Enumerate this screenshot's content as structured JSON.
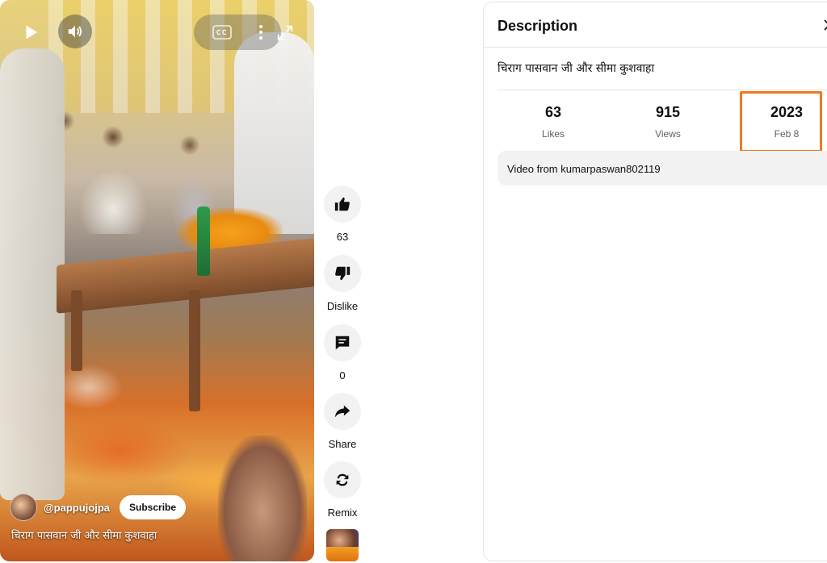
{
  "player": {
    "overlay": {
      "channel_handle": "@pappujojpa",
      "subscribe_label": "Subscribe",
      "title": "चिराग पासवान जी और सीमा कुशवाहा"
    },
    "icons": {
      "play": "play-icon",
      "volume": "volume-icon",
      "captions": "captions-icon",
      "more": "more-vertical-icon",
      "fullscreen": "fullscreen-icon"
    }
  },
  "rail": {
    "like": {
      "label": "63",
      "icon": "thumbs-up-icon"
    },
    "dislike": {
      "label": "Dislike",
      "icon": "thumbs-down-icon"
    },
    "comments": {
      "label": "0",
      "icon": "comment-icon"
    },
    "share": {
      "label": "Share",
      "icon": "share-icon"
    },
    "remix": {
      "label": "Remix",
      "icon": "remix-icon"
    }
  },
  "description": {
    "title": "Description",
    "text": "चिराग पासवान जी और सीमा कुशवाहा",
    "stats": {
      "likes": {
        "value": "63",
        "label": "Likes"
      },
      "views": {
        "value": "915",
        "label": "Views"
      },
      "date": {
        "value": "2023",
        "label": "Feb 8"
      }
    },
    "source": "Video from kumarpaswan802119"
  },
  "colors": {
    "highlight": "#f07820",
    "chip_background": "#f2f2f2",
    "border": "#e5e5e5"
  }
}
